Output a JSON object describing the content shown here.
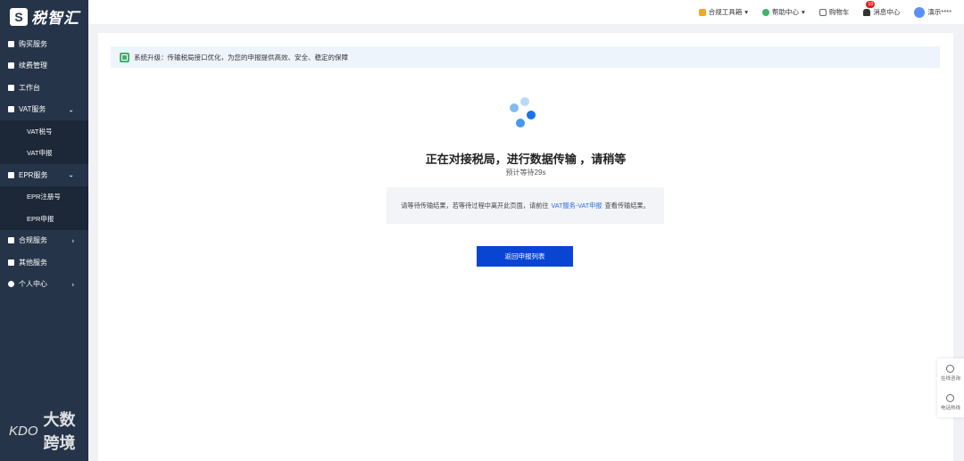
{
  "app": {
    "brand_mark": "S",
    "brand_name": "税智汇"
  },
  "sidebar": {
    "items": [
      {
        "label": "购买服务"
      },
      {
        "label": "续费管理"
      },
      {
        "label": "工作台"
      },
      {
        "label": "VAT服务",
        "expanded": true,
        "children": [
          {
            "label": "VAT税号"
          },
          {
            "label": "VAT申报"
          }
        ]
      },
      {
        "label": "EPR服务",
        "expanded": true,
        "children": [
          {
            "label": "EPR注册号"
          },
          {
            "label": "EPR申报"
          }
        ]
      },
      {
        "label": "合规服务"
      },
      {
        "label": "其他服务"
      },
      {
        "label": "个人中心"
      }
    ],
    "chevron_down": "⌄",
    "chevron_right": "›"
  },
  "watermark": {
    "logo": "KDO",
    "text": "大数跨境"
  },
  "topbar": {
    "toolbox": "合规工具箱",
    "help": "帮助中心",
    "cart": "购物车",
    "messages": "消息中心",
    "message_count": "10",
    "user": "演示****",
    "caret": "▾",
    "colors": {
      "toolbox": "#f5a623",
      "help": "#3fb26b",
      "cart": "#666666",
      "messages": "#333333"
    }
  },
  "notice": {
    "text": "系统升级：传输税局接口优化，为您的申报提供高效、安全、稳定的保障"
  },
  "status": {
    "title": "正在对接税局，进行数据传输 ，请稍等",
    "countdown": "预计等待29s",
    "info_before": "请等待传输结果，若等待过程中离开此页面，请前往",
    "info_link": "VAT服务-VAT申报",
    "info_after": "查看传输结果。",
    "button": "返回申报列表"
  },
  "float_panel": {
    "online": "在线咨询",
    "phone": "电话热线"
  },
  "colors": {
    "sidebar": "#263449",
    "accent": "#0845d3",
    "loader_dark": "#1a73e8",
    "loader_light": "#b9daf7"
  }
}
